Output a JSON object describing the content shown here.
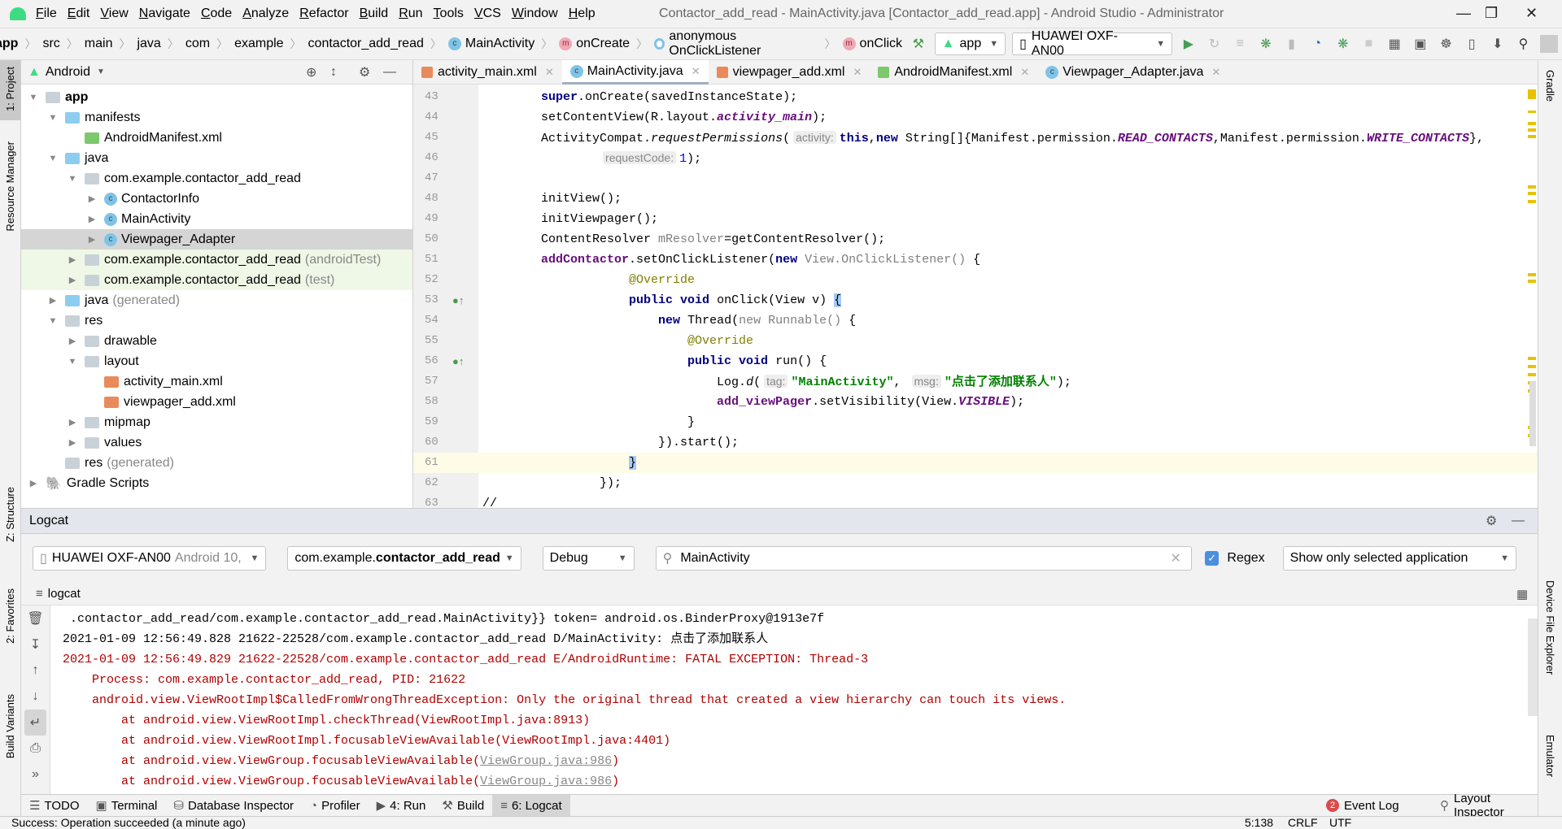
{
  "window": {
    "title": "Contactor_add_read - MainActivity.java [Contactor_add_read.app] - Android Studio - Administrator"
  },
  "menu": [
    "File",
    "Edit",
    "View",
    "Navigate",
    "Code",
    "Analyze",
    "Refactor",
    "Build",
    "Run",
    "Tools",
    "VCS",
    "Window",
    "Help"
  ],
  "breadcrumb": [
    {
      "label": "app",
      "icon": ""
    },
    {
      "label": "src",
      "icon": ""
    },
    {
      "label": "main",
      "icon": ""
    },
    {
      "label": "java",
      "icon": ""
    },
    {
      "label": "com",
      "icon": ""
    },
    {
      "label": "example",
      "icon": ""
    },
    {
      "label": "contactor_add_read",
      "icon": ""
    },
    {
      "label": "MainActivity",
      "icon": "class-icon"
    },
    {
      "label": "onCreate",
      "icon": "method-icon"
    },
    {
      "label": "anonymous OnClickListener",
      "icon": "anonymous-class-icon"
    },
    {
      "label": "onClick",
      "icon": "method-icon"
    }
  ],
  "toolbar": {
    "config": "app",
    "device": "HUAWEI OXF-AN00"
  },
  "project": {
    "view": "Android",
    "tree": [
      {
        "label": "app",
        "depth": 0,
        "arrow": "down",
        "icon": "module",
        "bold": true
      },
      {
        "label": "manifests",
        "depth": 1,
        "arrow": "down",
        "icon": "blue"
      },
      {
        "label": "AndroidManifest.xml",
        "depth": 2,
        "arrow": "",
        "icon": "mf"
      },
      {
        "label": "java",
        "depth": 1,
        "arrow": "down",
        "icon": "blue"
      },
      {
        "label": "com.example.contactor_add_read",
        "depth": 2,
        "arrow": "down",
        "icon": "folder"
      },
      {
        "label": "ContactorInfo",
        "depth": 3,
        "arrow": "right",
        "icon": "class"
      },
      {
        "label": "MainActivity",
        "depth": 3,
        "arrow": "right",
        "icon": "class"
      },
      {
        "label": "Viewpager_Adapter",
        "depth": 3,
        "arrow": "right",
        "icon": "class",
        "state": "sel"
      },
      {
        "label": "com.example.contactor_add_read",
        "suffix": "(androidTest)",
        "depth": 2,
        "arrow": "right",
        "icon": "folder",
        "state": "green"
      },
      {
        "label": "com.example.contactor_add_read",
        "suffix": "(test)",
        "depth": 2,
        "arrow": "right",
        "icon": "folder",
        "state": "green"
      },
      {
        "label": "java",
        "suffix": "(generated)",
        "depth": 1,
        "arrow": "right",
        "icon": "blue"
      },
      {
        "label": "res",
        "depth": 1,
        "arrow": "down",
        "icon": "folder"
      },
      {
        "label": "drawable",
        "depth": 2,
        "arrow": "right",
        "icon": "folder"
      },
      {
        "label": "layout",
        "depth": 2,
        "arrow": "down",
        "icon": "folder"
      },
      {
        "label": "activity_main.xml",
        "depth": 3,
        "arrow": "",
        "icon": "xml"
      },
      {
        "label": "viewpager_add.xml",
        "depth": 3,
        "arrow": "",
        "icon": "xml"
      },
      {
        "label": "mipmap",
        "depth": 2,
        "arrow": "right",
        "icon": "folder"
      },
      {
        "label": "values",
        "depth": 2,
        "arrow": "right",
        "icon": "folder"
      },
      {
        "label": "res",
        "suffix": "(generated)",
        "depth": 1,
        "arrow": "",
        "icon": "folder"
      },
      {
        "label": "Gradle Scripts",
        "depth": 0,
        "arrow": "right",
        "icon": "gradle"
      }
    ]
  },
  "tabs": [
    {
      "label": "activity_main.xml",
      "icon": "xml"
    },
    {
      "label": "MainActivity.java",
      "icon": "class",
      "active": true
    },
    {
      "label": "viewpager_add.xml",
      "icon": "xml"
    },
    {
      "label": "AndroidManifest.xml",
      "icon": "mf"
    },
    {
      "label": "Viewpager_Adapter.java",
      "icon": "class"
    }
  ],
  "code": [
    {
      "n": "43",
      "s": [
        [
          "        ",
          ""
        ],
        [
          "super",
          "kw"
        ],
        [
          ".onCreate(savedInstanceState);",
          ""
        ]
      ]
    },
    {
      "n": "44",
      "s": [
        [
          "        setContentView(R.layout.",
          ""
        ],
        [
          "activity_main",
          "fi"
        ],
        [
          ");",
          ""
        ]
      ]
    },
    {
      "n": "45",
      "s": [
        [
          "        ActivityCompat.",
          ""
        ],
        [
          "requestPermissions",
          "it"
        ],
        [
          "(",
          ""
        ],
        [
          "activity:",
          "hint"
        ],
        [
          "this",
          "kw"
        ],
        [
          ",",
          ""
        ],
        [
          "new ",
          "kw"
        ],
        [
          "String[]{Manifest.permission.",
          ""
        ],
        [
          "READ_CONTACTS",
          "fi"
        ],
        [
          ",Manifest.permission.",
          ""
        ],
        [
          "WRITE_CONTACTS",
          "fi"
        ],
        [
          "},",
          ""
        ]
      ]
    },
    {
      "n": "46",
      "s": [
        [
          "                ",
          ""
        ],
        [
          "requestCode:",
          "hint"
        ],
        [
          "1",
          "num"
        ],
        [
          ");",
          ""
        ]
      ]
    },
    {
      "n": "47",
      "s": []
    },
    {
      "n": "48",
      "s": [
        [
          "        initView();",
          ""
        ]
      ]
    },
    {
      "n": "49",
      "s": [
        [
          "        initViewpager();",
          ""
        ]
      ]
    },
    {
      "n": "50",
      "s": [
        [
          "        ContentResolver ",
          ""
        ],
        [
          "mResolver",
          "grey"
        ],
        [
          "=getContentResolver();",
          ""
        ]
      ]
    },
    {
      "n": "51",
      "s": [
        [
          "        ",
          ""
        ],
        [
          "addContactor",
          "fld"
        ],
        [
          ".setOnClickListener(",
          ""
        ],
        [
          "new ",
          "kw"
        ],
        [
          "View.OnClickListener()",
          "grey"
        ],
        [
          " {",
          ""
        ]
      ]
    },
    {
      "n": "52",
      "s": [
        [
          "                    ",
          ""
        ],
        [
          "@Override",
          "ann"
        ]
      ]
    },
    {
      "n": "53",
      "s": [
        [
          "                    ",
          ""
        ],
        [
          "public void ",
          "kw"
        ],
        [
          "onClick(View v) ",
          ""
        ],
        [
          "{",
          "brace"
        ]
      ],
      "gicon": true
    },
    {
      "n": "54",
      "s": [
        [
          "                        ",
          ""
        ],
        [
          "new ",
          "kw"
        ],
        [
          "Thread(",
          ""
        ],
        [
          "new Runnable()",
          "grey"
        ],
        [
          " {",
          ""
        ]
      ]
    },
    {
      "n": "55",
      "s": [
        [
          "                            ",
          ""
        ],
        [
          "@Override",
          "ann"
        ]
      ]
    },
    {
      "n": "56",
      "s": [
        [
          "                            ",
          ""
        ],
        [
          "public void ",
          "kw"
        ],
        [
          "run() {",
          ""
        ]
      ],
      "gicon": true
    },
    {
      "n": "57",
      "s": [
        [
          "                                Log.",
          ""
        ],
        [
          "d",
          "it"
        ],
        [
          "(",
          ""
        ],
        [
          "tag:",
          "hint"
        ],
        [
          "\"MainActivity\"",
          "str"
        ],
        [
          ", ",
          ""
        ],
        [
          "msg:",
          "hint"
        ],
        [
          "\"点击了添加联系人\"",
          "str"
        ],
        [
          ");",
          ""
        ]
      ]
    },
    {
      "n": "58",
      "s": [
        [
          "                                ",
          ""
        ],
        [
          "add_viewPager",
          "fld"
        ],
        [
          ".setVisibility(View.",
          ""
        ],
        [
          "VISIBLE",
          "fi"
        ],
        [
          ");",
          ""
        ]
      ]
    },
    {
      "n": "59",
      "s": [
        [
          "                            }",
          ""
        ]
      ]
    },
    {
      "n": "60",
      "s": [
        [
          "                        }).start();",
          ""
        ]
      ]
    },
    {
      "n": "61",
      "s": [
        [
          "                    ",
          ""
        ],
        [
          "}",
          "brace"
        ]
      ],
      "cur": true
    },
    {
      "n": "62",
      "s": [
        [
          "                });",
          ""
        ]
      ]
    },
    {
      "n": "63",
      "s": [
        [
          "//",
          ""
        ]
      ]
    }
  ],
  "logcat": {
    "title": "Logcat",
    "device": "HUAWEI OXF-AN00",
    "device_suffix": "Android 10,",
    "package_prefix": "com.example.",
    "package_bold": "contactor_add_read",
    "level": "Debug",
    "search": "MainActivity",
    "regex_label": "Regex",
    "regex_checked": true,
    "scope": "Show only selected application",
    "tab": "logcat",
    "lines": [
      {
        "text": " .contactor_add_read/com.example.contactor_add_read.MainActivity}} token= android.os.BinderProxy@1913e7f",
        "level": "d"
      },
      {
        "text": "2021-01-09 12:56:49.828 21622-22528/com.example.contactor_add_read D/MainActivity: 点击了添加联系人",
        "level": "d"
      },
      {
        "text": "2021-01-09 12:56:49.829 21622-22528/com.example.contactor_add_read E/AndroidRuntime: FATAL EXCEPTION: Thread-3",
        "level": "e"
      },
      {
        "text": "    Process: com.example.contactor_add_read, PID: 21622",
        "level": "e"
      },
      {
        "text": "    android.view.ViewRootImpl$CalledFromWrongThreadException: Only the original thread that created a view hierarchy can touch its views.",
        "level": "e"
      },
      {
        "text": "        at android.view.ViewRootImpl.checkThread(ViewRootImpl.java:8913)",
        "level": "e"
      },
      {
        "text": "        at android.view.ViewRootImpl.focusableViewAvailable(ViewRootImpl.java:4401)",
        "level": "e"
      },
      {
        "text": "        at android.view.ViewGroup.focusableViewAvailable(",
        "link": "ViewGroup.java:986",
        "after": ")",
        "level": "e"
      },
      {
        "text": "        at android.view.ViewGroup.focusableViewAvailable(",
        "link": "ViewGroup.java:986",
        "after": ")",
        "level": "e"
      }
    ]
  },
  "left_strip": [
    "1: Project",
    "Resource Manager",
    "Z: Structure",
    "2: Favorites",
    "Build Variants"
  ],
  "right_strip": [
    "Gradle",
    "Device File Explorer",
    "Emulator"
  ],
  "bottom_tools": [
    {
      "label": "TODO"
    },
    {
      "label": "Terminal"
    },
    {
      "label": "Database Inspector"
    },
    {
      "label": "Profiler"
    },
    {
      "label": "4: Run"
    },
    {
      "label": "Build"
    },
    {
      "label": "6: Logcat",
      "active": true
    }
  ],
  "bottom_right": {
    "event_log": "Event Log",
    "event_count": "2",
    "layout_inspector": "Layout Inspector"
  },
  "status": {
    "message": "Success: Operation succeeded (a minute ago)",
    "position": "5:138",
    "line_sep": "CRLF",
    "encoding": "UTF"
  },
  "colors": {
    "accent": "#3ddc84",
    "keyword": "#000080",
    "string": "#008000",
    "error": "#b00000",
    "current_line": "#fefbe7"
  }
}
